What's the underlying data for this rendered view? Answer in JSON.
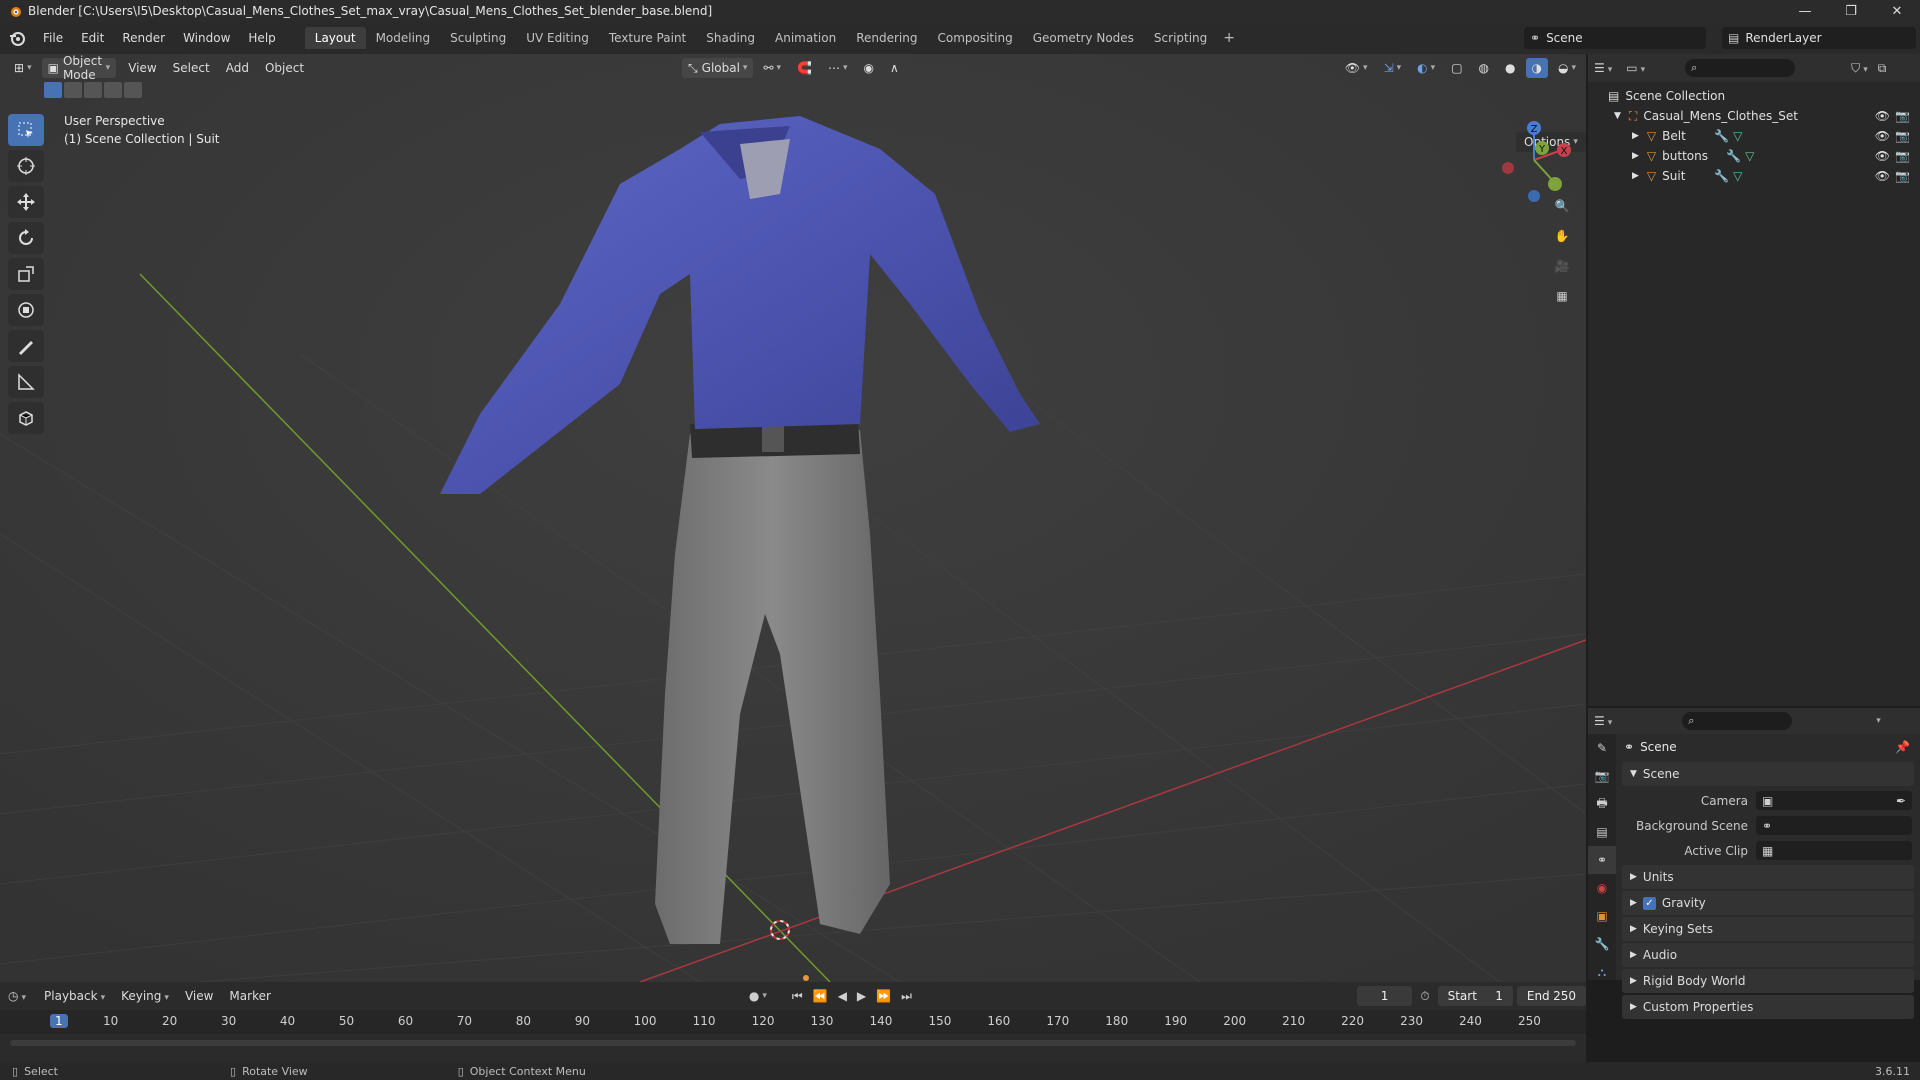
{
  "window": {
    "title": "Blender [C:\\Users\\I5\\Desktop\\Casual_Mens_Clothes_Set_max_vray\\Casual_Mens_Clothes_Set_blender_base.blend]",
    "controls": [
      "—",
      "❐",
      "✕"
    ]
  },
  "menu": [
    "File",
    "Edit",
    "Render",
    "Window",
    "Help"
  ],
  "workspaces": [
    "Layout",
    "Modeling",
    "Sculpting",
    "UV Editing",
    "Texture Paint",
    "Shading",
    "Animation",
    "Rendering",
    "Compositing",
    "Geometry Nodes",
    "Scripting"
  ],
  "workspace_active": "Layout",
  "scene_name": "Scene",
  "render_layer": "RenderLayer",
  "viewport": {
    "mode": "Object Mode",
    "menu": [
      "View",
      "Select",
      "Add",
      "Object"
    ],
    "orientation": "Global",
    "options_label": "Options",
    "info_line1": "User Perspective",
    "info_line2": "(1) Scene Collection | Suit",
    "gizmo_axes": [
      "X",
      "Y",
      "Z"
    ]
  },
  "outliner": {
    "root": "Scene Collection",
    "collection": "Casual_Mens_Clothes_Set",
    "objects": [
      "Belt",
      "buttons",
      "Suit"
    ]
  },
  "properties": {
    "context": "Scene",
    "panel_scene": "Scene",
    "fields": [
      {
        "label": "Camera"
      },
      {
        "label": "Background Scene"
      },
      {
        "label": "Active Clip"
      }
    ],
    "panels": [
      "Units",
      "Gravity",
      "Keying Sets",
      "Audio",
      "Rigid Body World",
      "Custom Properties"
    ],
    "gravity_checked": true
  },
  "timeline": {
    "menu": [
      "Playback",
      "Keying",
      "View",
      "Marker"
    ],
    "current_frame": "1",
    "start_label": "Start",
    "start": "1",
    "end_label": "End",
    "end": "250",
    "ruler": [
      "1",
      "10",
      "20",
      "30",
      "40",
      "50",
      "60",
      "70",
      "80",
      "90",
      "100",
      "110",
      "120",
      "130",
      "140",
      "150",
      "160",
      "170",
      "180",
      "190",
      "200",
      "210",
      "220",
      "230",
      "240",
      "250"
    ]
  },
  "status": {
    "select": "Select",
    "rotate": "Rotate View",
    "context_menu": "Object Context Menu",
    "version": "3.6.11"
  },
  "colors": {
    "accent": "#4772b3",
    "shirt": "#5058b8",
    "pants": "#7a7a7a",
    "x_axis": "#c6414d",
    "y_axis": "#7ea33a",
    "z_axis": "#4a7dcc",
    "object_orange": "#e0913a"
  }
}
